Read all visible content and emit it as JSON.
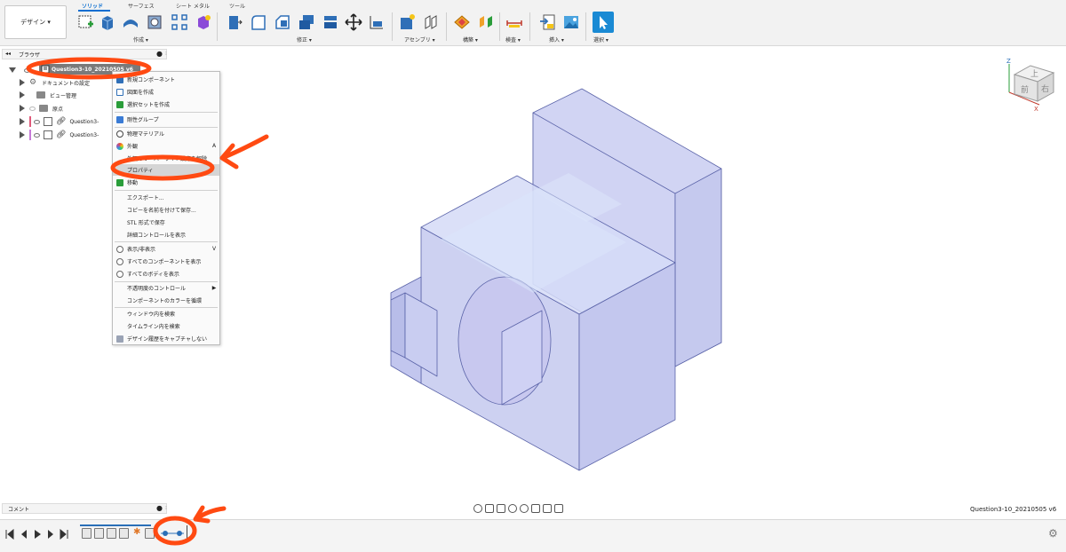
{
  "toolbar": {
    "workspace_label": "デザイン ▾",
    "tabs": [
      "ソリッド",
      "サーフェス",
      "シート メタル",
      "ツール"
    ],
    "groups": [
      "作成 ▾",
      "修正 ▾",
      "アセンブリ ▾",
      "構築 ▾",
      "検査 ▾",
      "挿入 ▾",
      "選択 ▾"
    ]
  },
  "browser": {
    "title": "ブラウザ",
    "root": "Question3-10_20210505 v6",
    "items": [
      "ドキュメントの設定",
      "ビュー管理",
      "原点",
      "Question3-",
      "Question3-"
    ]
  },
  "context_menu": {
    "items": [
      {
        "label": "新規コンポーネント",
        "shortcut": ""
      },
      {
        "label": "図面を作成",
        "shortcut": ""
      },
      {
        "label": "選択セットを作成",
        "shortcut": ""
      },
      {
        "label": "剛性グループ",
        "shortcut": ""
      },
      {
        "label": "物理マテリアル",
        "shortcut": ""
      },
      {
        "label": "外観",
        "shortcut": "A"
      },
      {
        "label": "外観のオーバーライド設定を解除",
        "shortcut": ""
      },
      {
        "label": "プロパティ",
        "shortcut": ""
      },
      {
        "label": "移動",
        "shortcut": ""
      },
      {
        "label": "エクスポート...",
        "shortcut": ""
      },
      {
        "label": "コピーを名前を付けて保存...",
        "shortcut": ""
      },
      {
        "label": "STL 形式で保存",
        "shortcut": ""
      },
      {
        "label": "詳細コントロールを表示",
        "shortcut": ""
      },
      {
        "label": "表示/非表示",
        "shortcut": "V"
      },
      {
        "label": "すべてのコンポーネントを表示",
        "shortcut": ""
      },
      {
        "label": "すべてのボディを表示",
        "shortcut": ""
      },
      {
        "label": "不透明度のコントロール",
        "shortcut": "▶"
      },
      {
        "label": "コンポーネントのカラーを循環",
        "shortcut": ""
      },
      {
        "label": "ウィンドウ内を検索",
        "shortcut": ""
      },
      {
        "label": "タイムライン内を検索",
        "shortcut": ""
      },
      {
        "label": "デザイン履歴をキャプチャしない",
        "shortcut": ""
      }
    ]
  },
  "viewcube": {
    "top": "上",
    "front": "前",
    "right": "右",
    "axis_x": "X",
    "axis_z": "Z"
  },
  "comment": {
    "title": "コメント"
  },
  "status": {
    "document_name": "Question3-10_20210505 v6"
  },
  "colors": {
    "accent": "#0a6ed1",
    "annotation": "#ff4a12",
    "model_fill": "#c9cdf1",
    "model_edge": "#5a63a8",
    "highlight": "#d5d5d5"
  },
  "icons": [
    "sketch-icon",
    "extrude-icon",
    "revolve-icon",
    "hole-icon",
    "fillet-icon",
    "move-icon",
    "joint-icon",
    "plane-icon",
    "measure-icon",
    "insert-icon",
    "select-icon",
    "gear-icon",
    "eye-icon",
    "link-icon"
  ]
}
